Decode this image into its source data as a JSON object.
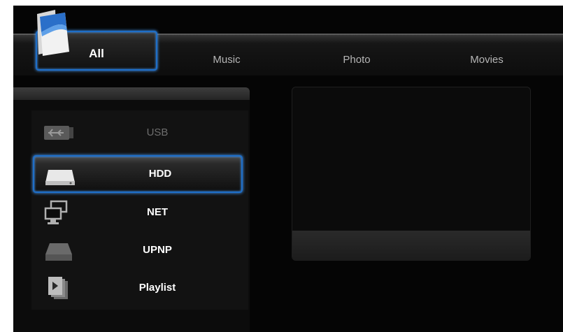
{
  "tabs": {
    "all": "All",
    "music": "Music",
    "photo": "Photo",
    "movies": "Movies"
  },
  "selected_tab": "All",
  "sources": [
    {
      "label": "USB",
      "icon": "usb-icon",
      "enabled": false
    },
    {
      "label": "HDD",
      "icon": "hdd-icon",
      "selected": true
    },
    {
      "label": "NET",
      "icon": "network-icon"
    },
    {
      "label": "UPNP",
      "icon": "upnp-icon"
    },
    {
      "label": "Playlist",
      "icon": "playlist-icon"
    }
  ],
  "colors": {
    "focus_border": "#1e6ec8",
    "background": "#050505",
    "text": "#ffffff",
    "disabled_text": "#6e6e6e"
  }
}
